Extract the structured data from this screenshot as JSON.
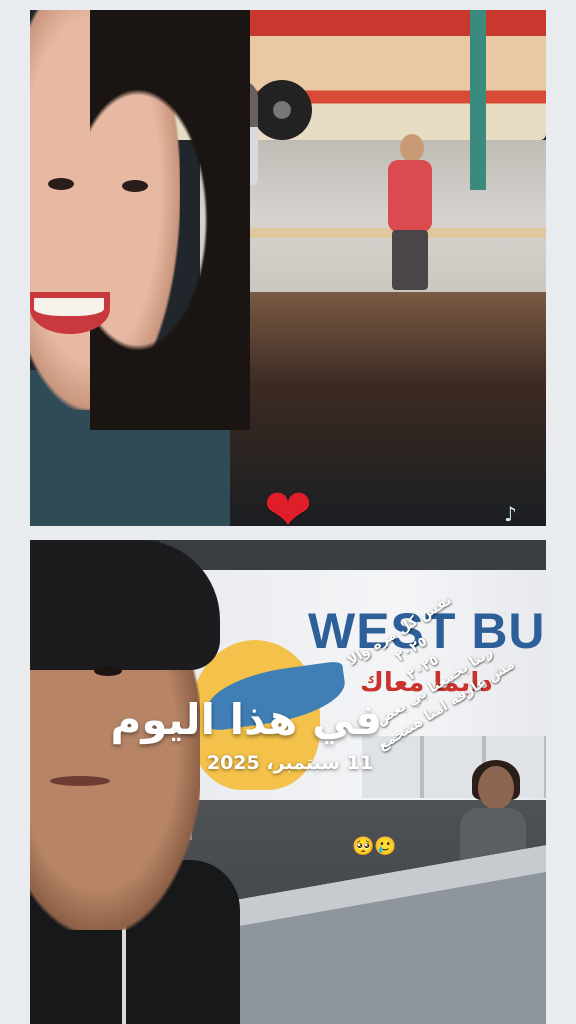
{
  "overlay": {
    "title": "في هذا اليوم",
    "date": "11 سبتمبر، 2025",
    "caption_lines": [
      "نفس كل مره والا",
      "٢٠٢٥",
      "٢٠٢٥",
      "ربنا يجمعنا بي بعض",
      "مش عارفه امتا هنتجمع"
    ],
    "emojis": "🥺🥲",
    "heart": "❤"
  },
  "photos": {
    "top": {
      "bus_text": "",
      "logo": "♪"
    },
    "bottom": {
      "bus_text": "WEST BUS",
      "bus_red_text": "دايما معاك"
    }
  },
  "colors": {
    "background": "#e9ecef",
    "heart": "#e01e2a",
    "bus_blue": "#2d5f99",
    "bus_red": "#c8342d",
    "text": "#ffffff"
  }
}
